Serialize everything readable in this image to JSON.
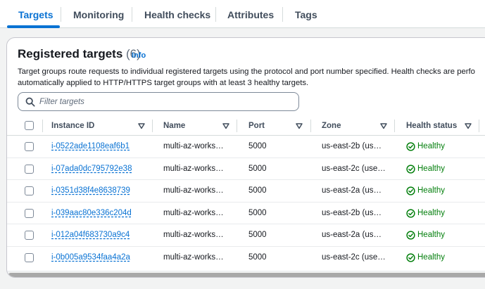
{
  "tabs": [
    {
      "label": "Targets",
      "active": true
    },
    {
      "label": "Monitoring",
      "active": false
    },
    {
      "label": "Health checks",
      "active": false
    },
    {
      "label": "Attributes",
      "active": false
    },
    {
      "label": "Tags",
      "active": false
    }
  ],
  "panel": {
    "title": "Registered targets",
    "count": "(6)",
    "info_label": "Info",
    "description_line1": "Target groups route requests to individual registered targets using the protocol and port number specified. Health checks are perfo",
    "description_line2": "automatically applied to HTTP/HTTPS target groups with at least 3 healthy targets."
  },
  "filter": {
    "placeholder": "Filter targets",
    "value": ""
  },
  "table": {
    "columns": [
      "Instance ID",
      "Name",
      "Port",
      "Zone",
      "Health status"
    ],
    "rows": [
      {
        "instance_id": "i-0522ade1108eaf6b1",
        "name": "multi-az-works…",
        "port": "5000",
        "zone": "us-east-2b (us…",
        "health": "Healthy"
      },
      {
        "instance_id": "i-07ada0dc795792e38",
        "name": "multi-az-works…",
        "port": "5000",
        "zone": "us-east-2c (use…",
        "health": "Healthy"
      },
      {
        "instance_id": "i-0351d38f4e8638739",
        "name": "multi-az-works…",
        "port": "5000",
        "zone": "us-east-2a (us…",
        "health": "Healthy"
      },
      {
        "instance_id": "i-039aac80e336c204d",
        "name": "multi-az-works…",
        "port": "5000",
        "zone": "us-east-2b (us…",
        "health": "Healthy"
      },
      {
        "instance_id": "i-012a04f683730a9c4",
        "name": "multi-az-works…",
        "port": "5000",
        "zone": "us-east-2a (us…",
        "health": "Healthy"
      },
      {
        "instance_id": "i-0b005a9534faa4a2a",
        "name": "multi-az-works…",
        "port": "5000",
        "zone": "us-east-2c (use…",
        "health": "Healthy"
      }
    ]
  },
  "icons": {
    "search": "search-icon",
    "sort": "sort-caret-icon",
    "health": "status-positive-icon"
  },
  "colors": {
    "accent": "#0972d3",
    "healthy": "#037f0c",
    "text": "#16191f"
  }
}
